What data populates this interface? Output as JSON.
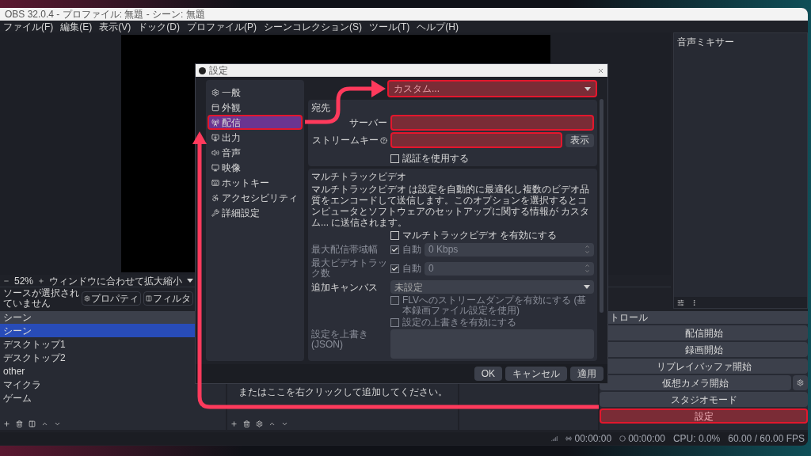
{
  "window": {
    "title": "OBS 32.0.4 - プロファイル: 無題 - シーン: 無題"
  },
  "menu": [
    "ファイル(F)",
    "編集(E)",
    "表示(V)",
    "ドック(D)",
    "プロファイル(P)",
    "シーンコレクション(S)",
    "ツール(T)",
    "ヘルプ(H)"
  ],
  "preview": {
    "zoom": "52%",
    "fit_label": "ウィンドウに合わせて拡大縮小"
  },
  "source_bar": {
    "status": "ソースが選択されていません",
    "buttons": [
      "プロパティ",
      "フィルタ"
    ]
  },
  "mixer": {
    "title": "音声ミキサー"
  },
  "scenes": {
    "title": "シーン",
    "items": [
      {
        "label": "シーン",
        "selected": true
      },
      {
        "label": "デスクトップ1",
        "selected": false
      },
      {
        "label": "デスクトップ2",
        "selected": false
      },
      {
        "label": "other",
        "selected": false
      },
      {
        "label": "マイクラ",
        "selected": false
      },
      {
        "label": "ゲーム",
        "selected": false
      }
    ]
  },
  "sources": {
    "hint": "またはここを右クリックして追加してください。"
  },
  "controls": {
    "title": "トロール",
    "buttons": [
      {
        "label": "配信開始",
        "highlighted": false,
        "has_settings": false
      },
      {
        "label": "録画開始",
        "highlighted": false,
        "has_settings": false
      },
      {
        "label": "リプレイバッファ開始",
        "highlighted": false,
        "has_settings": false
      },
      {
        "label": "仮想カメラ開始",
        "highlighted": false,
        "has_settings": true
      },
      {
        "label": "スタジオモード",
        "highlighted": false,
        "has_settings": false
      },
      {
        "label": "設定",
        "highlighted": true,
        "has_settings": false
      }
    ]
  },
  "status_bar": [
    "00:00:00",
    "00:00:00",
    "CPU: 0.0%",
    "60.00 / 60.00 FPS"
  ],
  "dialog": {
    "title": "設定",
    "sidebar": [
      {
        "label": "一般",
        "selected": false,
        "highlighted": false
      },
      {
        "label": "外観",
        "selected": false,
        "highlighted": false
      },
      {
        "label": "配信",
        "selected": true,
        "highlighted": true
      },
      {
        "label": "出力",
        "selected": false,
        "highlighted": false
      },
      {
        "label": "音声",
        "selected": false,
        "highlighted": false
      },
      {
        "label": "映像",
        "selected": false,
        "highlighted": false
      },
      {
        "label": "ホットキー",
        "selected": false,
        "highlighted": false
      },
      {
        "label": "アクセシビリティ",
        "selected": false,
        "highlighted": false
      },
      {
        "label": "詳細設定",
        "selected": false,
        "highlighted": false
      }
    ],
    "service": {
      "value": "カスタム...",
      "highlighted": true
    },
    "destination": {
      "title": "宛先",
      "server": {
        "label": "サーバー",
        "highlighted": true
      },
      "stream_key": {
        "label": "ストリームキー",
        "button": "表示",
        "highlighted": true
      },
      "auth": {
        "label": "認証を使用する",
        "checked": false
      }
    },
    "multitrack": {
      "title": "マルチトラックビデオ",
      "description": "マルチトラックビデオ は設定を自動的に最適化し複数のビデオ品質をエンコードして送信します。このオプションを選択するとコンピュータとソフトウェアのセットアップに関する情報が カスタム... に送信されます。",
      "enable": {
        "label": "マルチトラックビデオ を有効にする",
        "checked": false
      },
      "bandwidth": {
        "label": "最大配信帯域幅",
        "auto_label": "自動",
        "auto_checked": true,
        "value": "0 Kbps",
        "disabled": true
      },
      "tracks": {
        "label": "最大ビデオトラック数",
        "auto_label": "自動",
        "auto_checked": true,
        "value": "0",
        "disabled": true
      },
      "canvas": {
        "label": "追加キャンバス",
        "value": "未設定"
      },
      "flv": {
        "label": "FLVへのストリームダンプを有効にする (基本録画ファイル設定を使用)",
        "checked": false,
        "disabled": true
      },
      "override": {
        "label": "設定の上書きを有効にする",
        "checked": false,
        "disabled": true
      },
      "json": {
        "label": "設定を上書き (JSON)"
      }
    },
    "buttons": [
      "OK",
      "キャンセル",
      "適用"
    ]
  }
}
